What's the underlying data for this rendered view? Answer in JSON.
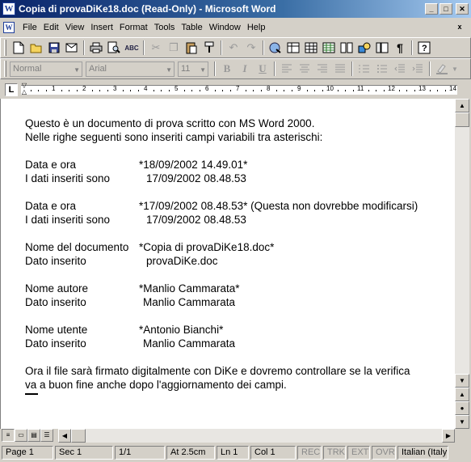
{
  "window": {
    "title": "Copia di provaDiKe18.doc (Read-Only) - Microsoft Word",
    "app_icon": "word-icon",
    "minimize": "_",
    "maximize": "□",
    "close": "✕"
  },
  "menu": {
    "items": [
      {
        "label": "File"
      },
      {
        "label": "Edit"
      },
      {
        "label": "View"
      },
      {
        "label": "Insert"
      },
      {
        "label": "Format"
      },
      {
        "label": "Tools"
      },
      {
        "label": "Table"
      },
      {
        "label": "Window"
      },
      {
        "label": "Help"
      }
    ],
    "doc_close": "x"
  },
  "toolbar_standard": {
    "icons": [
      "new-document-icon",
      "open-folder-icon",
      "save-icon",
      "email-icon",
      "print-icon",
      "print-preview-icon",
      "spelling-icon",
      "cut-icon",
      "copy-icon",
      "paste-icon",
      "format-painter-icon",
      "undo-icon",
      "redo-icon",
      "hyperlink-icon",
      "tables-borders-icon",
      "insert-table-icon",
      "insert-excel-icon",
      "columns-icon",
      "drawing-icon",
      "document-map-icon",
      "show-formatting-icon",
      "help-icon"
    ]
  },
  "toolbar_formatting": {
    "style": "Normal",
    "font": "Arial",
    "size": "11",
    "bold": "B",
    "italic": "I",
    "underline": "U"
  },
  "ruler": {
    "tab_selector": "L",
    "numbers": [
      "1",
      "2",
      "3",
      "4",
      "5",
      "6",
      "7",
      "8",
      "9",
      "10",
      "11",
      "12",
      "13",
      "14"
    ]
  },
  "document": {
    "intro": [
      "Questo è un documento di prova scritto con MS Word 2000.",
      "Nelle righe seguenti sono inseriti campi variabili tra asterischi:"
    ],
    "block1": {
      "label1": "Data e ora",
      "value1": "*18/09/2002 14.49.01*",
      "label2": "I dati inseriti sono",
      "value2": "17/09/2002 08.48.53"
    },
    "block2": {
      "label1": "Data e ora",
      "value1": "*17/09/2002 08.48.53* (Questa non dovrebbe modificarsi)",
      "label2": "I dati inseriti sono",
      "value2": "17/09/2002 08.48.53"
    },
    "block3": {
      "label1": "Nome del documento",
      "value1": "*Copia di provaDiKe18.doc*",
      "label2": "Dato inserito",
      "value2": "provaDiKe.doc"
    },
    "block4": {
      "label1": "Nome autore",
      "value1": "*Manlio Cammarata*",
      "label2": "Dato inserito",
      "value2": "Manlio Cammarata"
    },
    "block5": {
      "label1": "Nome utente",
      "value1": "*Antonio Bianchi*",
      "label2": "Dato inserito",
      "value2": "Manlio Cammarata"
    },
    "closing": [
      "Ora il file sarà firmato digitalmente con DiKe e dovremo controllare se la verifica",
      "va a buon fine anche dopo l'aggiornamento dei campi."
    ]
  },
  "statusbar": {
    "page": "Page 1",
    "sec": "Sec 1",
    "pages": "1/1",
    "at": "At 2.5cm",
    "ln": "Ln 1",
    "col": "Col 1",
    "rec": "REC",
    "trk": "TRK",
    "ext": "EXT",
    "ovr": "OVR",
    "language": "Italian (Italy"
  }
}
